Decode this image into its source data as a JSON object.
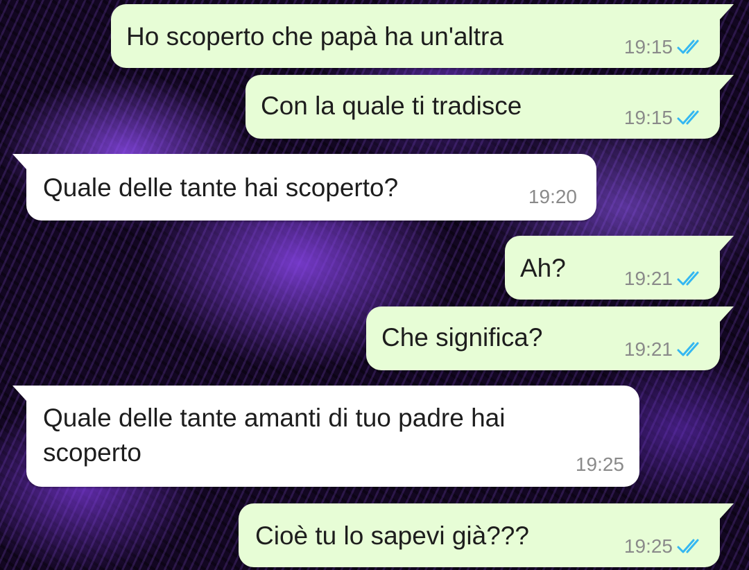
{
  "wallpaper": {
    "palette": [
      "#120621",
      "#8c4cf0",
      "#a066ff"
    ]
  },
  "colors": {
    "outgoing_bubble": "#e7fdd6",
    "incoming_bubble": "#ffffff",
    "read_ticks": "#34b7f1",
    "timestamp": "#8a8a8a"
  },
  "messages": [
    {
      "direction": "outgoing",
      "text": "Ho scoperto che papà ha un'altra",
      "time": "19:15",
      "status_icon": "double-check-read-icon"
    },
    {
      "direction": "outgoing",
      "text": "Con la quale ti tradisce",
      "time": "19:15",
      "status_icon": "double-check-read-icon"
    },
    {
      "direction": "incoming",
      "text": "Quale delle tante hai scoperto?",
      "time": "19:20"
    },
    {
      "direction": "outgoing",
      "text": "Ah?",
      "time": "19:21",
      "status_icon": "double-check-read-icon"
    },
    {
      "direction": "outgoing",
      "text": "Che significa?",
      "time": "19:21",
      "status_icon": "double-check-read-icon"
    },
    {
      "direction": "incoming",
      "text_line1": "Quale delle tante amanti di tuo padre hai",
      "text_line2": "scoperto",
      "time": "19:25"
    },
    {
      "direction": "outgoing",
      "text": "Cioè tu lo sapevi già???",
      "time": "19:25",
      "status_icon": "double-check-read-icon"
    }
  ]
}
